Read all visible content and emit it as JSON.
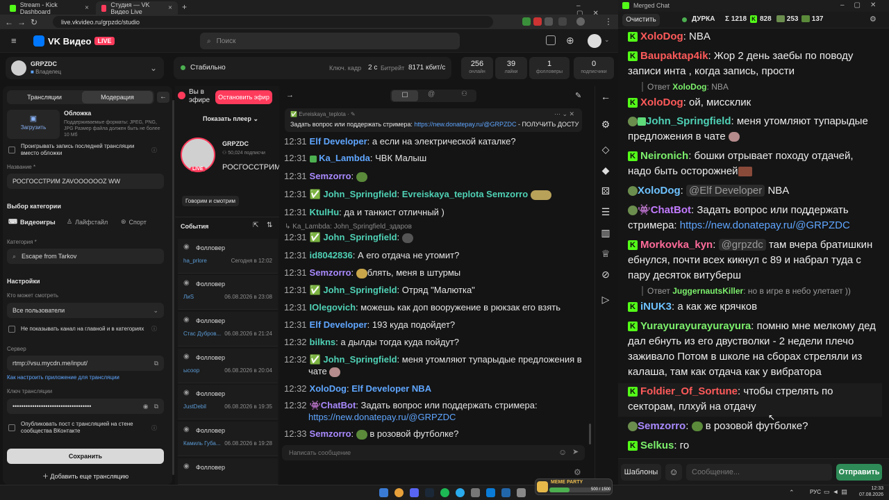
{
  "browser": {
    "tabs": [
      {
        "label": "Stream - Kick Dashboard",
        "color": "#53fc18"
      },
      {
        "label": "Студия — VK Видео Live",
        "color": "#ff3b5c"
      }
    ],
    "url": "live.vkvideo.ru/grpzdc/studio"
  },
  "vk": {
    "logo": "VK Видео",
    "live_badge": "LIVE",
    "search_placeholder": "Поиск"
  },
  "channel": {
    "name": "GRPZDC",
    "role": "Владелец"
  },
  "status": {
    "label": "Стабильно",
    "keyframe_label": "Ключ. кадр",
    "keyframe_value": "2 с",
    "bitrate_label": "Битрейт",
    "bitrate_value": "8171 кбит/с"
  },
  "stats": [
    {
      "value": "256",
      "label": "онлайн"
    },
    {
      "value": "39",
      "label": "лайки"
    },
    {
      "value": "1",
      "label": "фолловеры"
    },
    {
      "value": "0",
      "label": "подписчики"
    }
  ],
  "settings_panel": {
    "tab_streams": "Трансляции",
    "tab_moderation": "Модерация",
    "cover_title": "Обложка",
    "upload_label": "Загрузить",
    "cover_hint": "Поддерживаемые форматы: JPEG, PNG, JPG Размер файла должен быть не более 10 Мб",
    "play_last_label": "Проигрывать запись последней трансляции вместо обложки",
    "title_label": "Название *",
    "title_value": "РОСГОССТРИМ ZAVOOOOOOZ WW",
    "category_section": "Выбор категории",
    "cat_videogames": "Видеоигры",
    "cat_lifestyle": "Лайфстайл",
    "cat_sport": "Спорт",
    "category_label": "Категория *",
    "category_value": "Escape from Tarkov",
    "settings_title": "Настройки",
    "who_can_watch_label": "Кто может смотреть",
    "who_can_watch_value": "Все пользователи",
    "hide_channel_label": "Не показывать канал на главной и в категориях",
    "server_label": "Сервер",
    "server_value": "rtmp://vsu.mycdn.me/input/",
    "setup_link": "Как настроить приложение для трансляции",
    "key_label": "Ключ трансляции",
    "key_value": "••••••••••••••••••••••••••••••••••••",
    "publish_label": "Опубликовать пост с трансляцией на стене сообщества ВКонтакте",
    "save_button": "Сохранить",
    "add_stream_button": "Добавить еще трансляцию"
  },
  "live_panel": {
    "on_air": "Вы в эфире",
    "stop_button": "Остановить эфир",
    "show_player": "Показать плеер",
    "channel_name": "GRPZDC",
    "subscribers": "50,024 подписчи",
    "stream_title": "РОСГОССТРИМ ZAVOOOOOOZ",
    "live_tag": "LIVE",
    "category_tag": "Говорим и смотрим",
    "events_title": "События"
  },
  "events": [
    {
      "type": "Фолловер",
      "user": "ha_prlore",
      "date": "Сегодня в 12:02"
    },
    {
      "type": "Фолловер",
      "user": "ЛиS",
      "date": "06.08.2026 в 23:08"
    },
    {
      "type": "Фолловер",
      "user": "Стас Дубров...",
      "date": "06.08.2026 в 21:24"
    },
    {
      "type": "Фолловер",
      "user": "ысоор",
      "date": "06.08.2026 в 20:04"
    },
    {
      "type": "Фолловер",
      "user": "JustDebil",
      "date": "06.08.2026 в 19:35"
    },
    {
      "type": "Фолловер",
      "user": "Камиль Губа...",
      "date": "06.08.2026 в 19:28"
    },
    {
      "type": "Фолловер",
      "user": "",
      "date": ""
    }
  ],
  "vk_chat": {
    "pinned_user": "Evreiskaya_teplota",
    "pinned_text": "Задать вопрос или поддержать стримера:",
    "pinned_link": "https://new.donatepay.ru/@GRPZDC",
    "pinned_tail": "- ПОЛУЧИТЬ ДОСТУП ...",
    "reply_preview": "Ka_Lambda: John_Springfield_здаров",
    "input_placeholder": "Написать сообщение",
    "messages": [
      {
        "t": "12:31",
        "u": "Elf Developer",
        "m": "а если на электрической каталке?"
      },
      {
        "t": "12:31",
        "u": "Ka_Lambda",
        "m": "ЧВК Малыш"
      },
      {
        "t": "12:31",
        "u": "Semzorro",
        "m": ""
      },
      {
        "t": "12:31",
        "u": "John_Springfield",
        "m": "Evreiskaya_teplota Semzorro"
      },
      {
        "t": "12:31",
        "u": "KtulHu",
        "m": "да и танкист отличный )"
      },
      {
        "t": "12:31",
        "u": "John_Springfield",
        "m": ""
      },
      {
        "t": "12:31",
        "u": "id8042836",
        "m": "А его отдача не утомит?"
      },
      {
        "t": "12:31",
        "u": "Semzorro",
        "m": "блять, меня в штурмы"
      },
      {
        "t": "12:31",
        "u": "John_Springfield",
        "m": "Отряд \"Малютка\""
      },
      {
        "t": "12:31",
        "u": "IOlegovich",
        "m": "можешь как доп вооружение в рюкзак его взять"
      },
      {
        "t": "12:31",
        "u": "Elf Developer",
        "m": "193 куда подойдет?"
      },
      {
        "t": "12:32",
        "u": "bilkns",
        "m": "а дылды тогда куда пойдут?"
      },
      {
        "t": "12:32",
        "u": "John_Springfield",
        "m": "меня утомляют тупарыдые предложения в",
        "m2": "чате"
      },
      {
        "t": "12:32",
        "u": "XoloDog",
        "m": "Elf Developer  NBA"
      },
      {
        "t": "12:32",
        "u": "ChatBot",
        "m": "Задать вопрос или поддержать стримера:",
        "m2": "https://new.donatepay.ru/@GRPZDC"
      },
      {
        "t": "12:33",
        "u": "Semzorro",
        "m": "в розовой футболке?"
      }
    ]
  },
  "merged": {
    "title": "Merged Chat",
    "clear_button": "Очистить",
    "channel": "ДУРКА",
    "total": "Σ 1218",
    "kick_count": "828",
    "twitch_count": "253",
    "vk_count": "137",
    "templates_button": "Шаблоны",
    "input_placeholder": "Сообщение...",
    "send_button": "Отправить",
    "reply_label": "Ответ",
    "messages": [
      {
        "u": "XoloDog",
        "m": "NBA"
      },
      {
        "u": "Baupaktap4ik",
        "m": "Жор 2 день заебы по поводу",
        "m2": "записи инта , когда запись, прости",
        "reply_user": "XoloDog",
        "reply_text": "NBA"
      },
      {
        "u": "XoloDog",
        "m": "ой, миссклик"
      },
      {
        "u": "John_Springfield",
        "m": "меня утомляют тупарыдые",
        "m2": "предложения в чате"
      },
      {
        "u": "Neironich",
        "m": "бошки отрывает походу отдачей,",
        "m2": "надо быть осторожней"
      },
      {
        "u": "XoloDog",
        "mention": "@Elf Developer",
        "m": "NBA"
      },
      {
        "u": "ChatBot",
        "m": "Задать вопрос или поддержать",
        "m2": "стримера:",
        "link": "https://new.donatepay.ru/@GRPZDC"
      },
      {
        "u": "Morkovka_kyn",
        "mention": "@grpzdc",
        "m": "там вчера братишкин",
        "m2": "ебнулся, почти всех кикнул с 89 и набрал туда с",
        "m3": "пару десяток витуберш",
        "reply_user": "JuggernautsKiller",
        "reply_text": "но в игре в небо улетает ))"
      },
      {
        "u": "iNUK3",
        "m": "а как же крячков"
      },
      {
        "u": "Yurayurayurayurayura",
        "m": "помню мне мелкому дед",
        "m2": "дал ебнуть из его двустволки - 2 недели плечо",
        "m3": "заживало Потом в школе на сборах стреляли из",
        "m4": "калаша, там как отдача как у вибратора"
      },
      {
        "u": "Foldier_Of_Sortune",
        "m": "чтобы стрелять по",
        "m2": "секторам, плхуй на отдачу"
      },
      {
        "u": "Semzorro",
        "m": "в розовой футболке?"
      },
      {
        "u": "Selkus",
        "m": "го"
      }
    ]
  },
  "taskbar": {
    "lang": "РУС",
    "time": "12:33",
    "date": "07.08.2026",
    "widget_title": "МЕМЕ PARTY",
    "widget_progress": "500 / 1500"
  },
  "colors": {
    "kick": "#53fc18",
    "vk_live": "#ff3b5c",
    "send_green": "#2e8b57",
    "stop_red": "#ff3b5c"
  }
}
